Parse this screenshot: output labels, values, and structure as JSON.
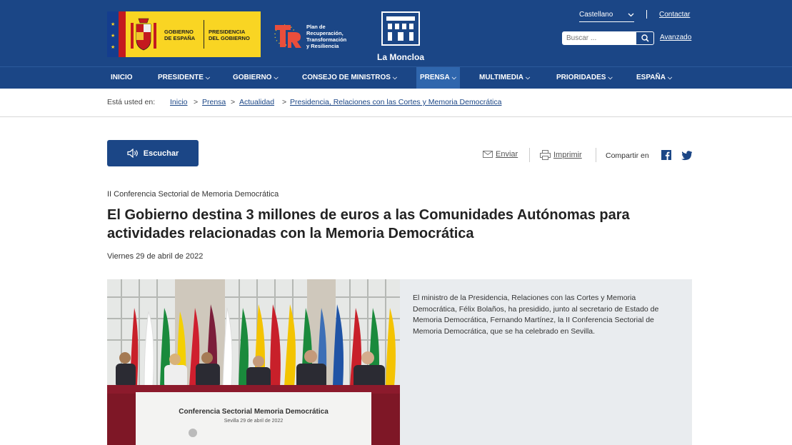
{
  "header": {
    "gob_line1": "GOBIERNO",
    "gob_line2": "DE ESPAÑA",
    "pres_line1": "PRESIDENCIA",
    "pres_line2": "DEL GOBIERNO",
    "prtr_line1": "Plan de",
    "prtr_line2": "Recuperación,",
    "prtr_line3": "Transformación",
    "prtr_line4": "y Resiliencia",
    "moncloa": "La Moncloa",
    "language": "Castellano",
    "contact": "Contactar",
    "search_placeholder": "Buscar ...",
    "advanced": "Avanzado"
  },
  "nav": {
    "items": [
      {
        "label": "INICIO"
      },
      {
        "label": "PRESIDENTE"
      },
      {
        "label": "GOBIERNO"
      },
      {
        "label": "CONSEJO DE MINISTROS"
      },
      {
        "label": "PRENSA"
      },
      {
        "label": "MULTIMEDIA"
      },
      {
        "label": "PRIORIDADES"
      },
      {
        "label": "ESPAÑA"
      }
    ]
  },
  "breadcrumb": {
    "label": "Está usted en:",
    "items": [
      "Inicio",
      "Prensa",
      "Actualidad",
      "Presidencia, Relaciones con las Cortes y Memoria Democrática"
    ]
  },
  "toolbar": {
    "listen": "Escuchar",
    "send": "Enviar",
    "print": "Imprimir",
    "share": "Compartir en"
  },
  "article": {
    "kicker": "II Conferencia Sectorial de Memoria Democrática",
    "title": "El Gobierno destina 3 millones de euros a las Comunidades Autónomas para actividades relacionadas con la Memoria Democrática",
    "date": "Viernes 29 de abril de 2022",
    "summary": "El ministro de la Presidencia, Relaciones con las Cortes y Memoria Democrática, Félix Bolaños, ha presidido, junto al secretario de Estado de Memoria Democrática, Fernando Martínez, la II Conferencia Sectorial de Memoria Democrática, que se ha celebrado en Sevilla.",
    "photo_banner_title": "Conferencia Sectorial Memoria Democrática",
    "photo_banner_sub": "Sevilla 29 de abril de 2022"
  },
  "colors": {
    "brand_blue": "#1b4686",
    "nav_active": "#2f66ad",
    "gov_yellow": "#f9d523",
    "summary_bg": "#e9ecef"
  }
}
